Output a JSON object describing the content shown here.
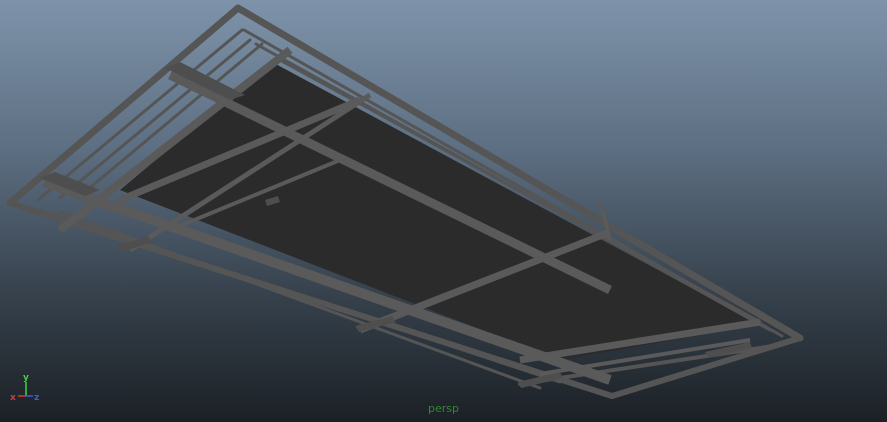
{
  "viewport": {
    "camera_name": "persp",
    "camera_label_color": "#2f8a2f"
  },
  "axis_gizmo": {
    "x_label": "x",
    "y_label": "y",
    "z_label": "z",
    "x_color": "#d23a3a",
    "y_color": "#3fd23f",
    "z_color": "#3a5ed2"
  },
  "model": {
    "icon": "ceiling-frame-model",
    "panel_color": "#2b2b2b",
    "frame_color": "#555555",
    "edge_color": "#1e1e1e"
  }
}
